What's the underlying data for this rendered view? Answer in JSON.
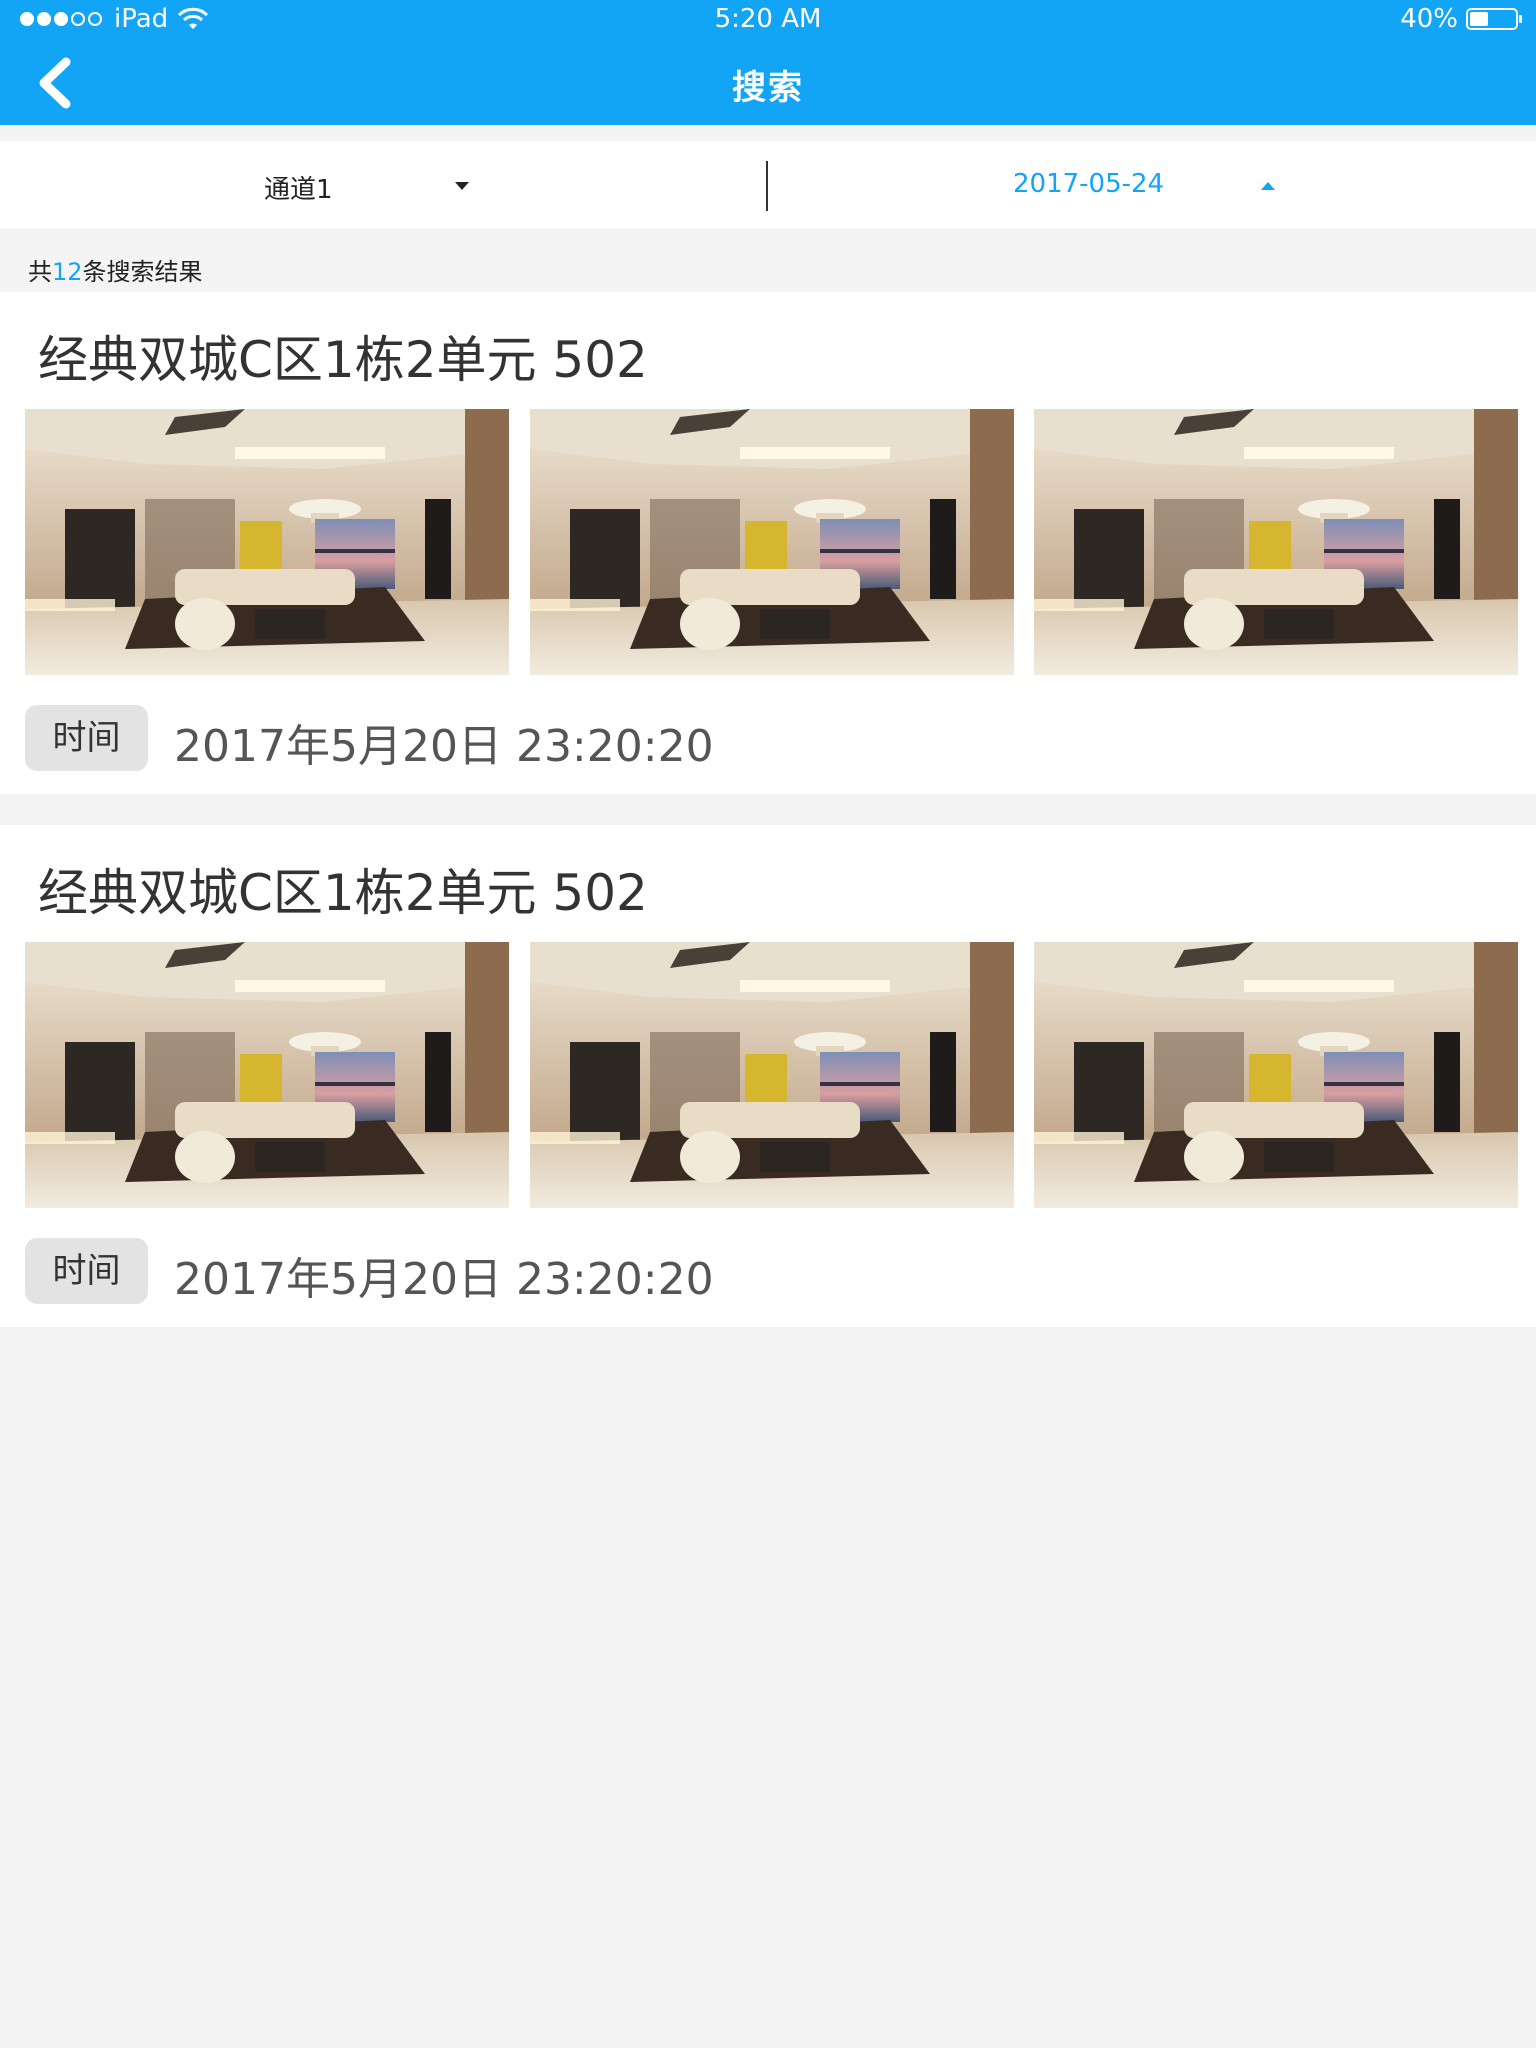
{
  "status_bar": {
    "carrier": "iPad",
    "time": "5:20 AM",
    "battery": "40%",
    "signal_icon": "signal-dots-icon",
    "wifi_icon": "wifi-icon",
    "battery_icon": "battery-icon"
  },
  "nav": {
    "title": "搜索",
    "back_icon": "chevron-left-icon"
  },
  "filters": {
    "channel": "通道1",
    "date": "2017-05-24"
  },
  "results": {
    "prefix": "共",
    "count": "12",
    "suffix": "条搜索结果"
  },
  "cards": [
    {
      "title": "经典双城C区1栋2单元 502",
      "time_label": "时间",
      "time_value": "2017年5月20日 23:20:20",
      "images": [
        "living-room-photo",
        "living-room-photo",
        "living-room-photo"
      ]
    },
    {
      "title": "经典双城C区1栋2单元 502",
      "time_label": "时间",
      "time_value": "2017年5月20日 23:20:20",
      "images": [
        "living-room-photo",
        "living-room-photo",
        "living-room-photo"
      ]
    }
  ],
  "colors": {
    "accent": "#13a5f5",
    "background": "#f4f4f4",
    "card": "#ffffff",
    "badge": "#e3e3e3"
  }
}
